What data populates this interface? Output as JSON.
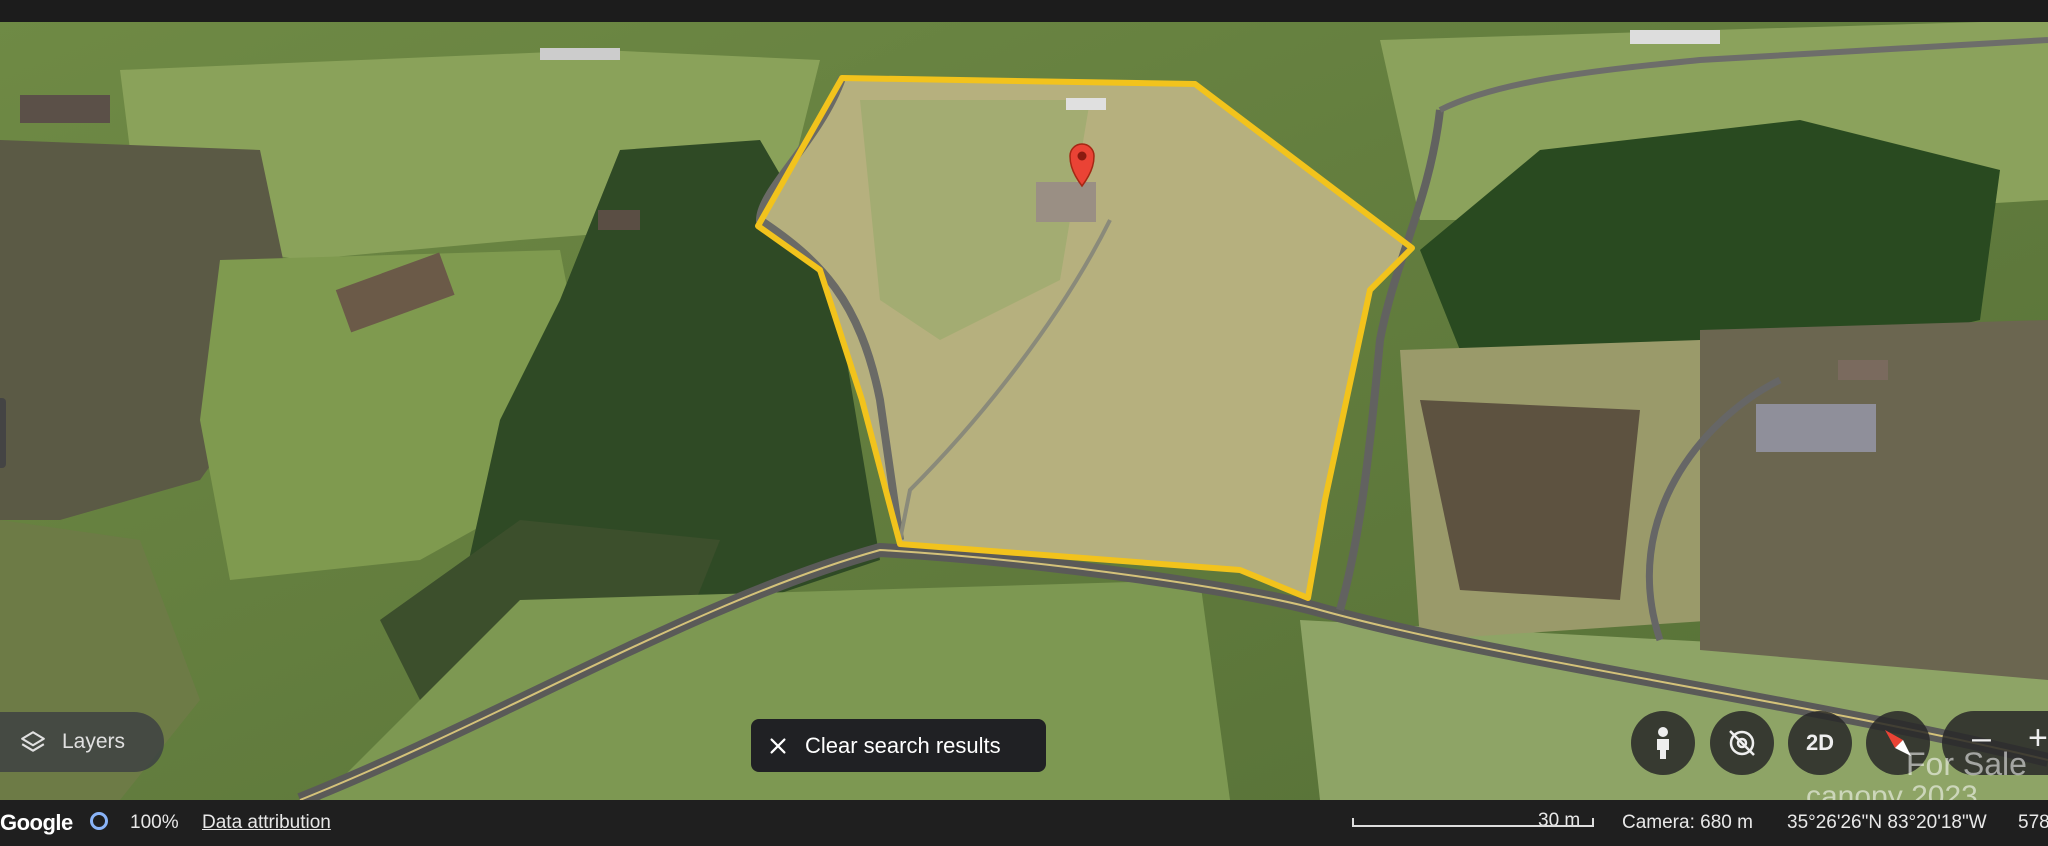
{
  "map": {
    "boundary_color": "#f2c31c",
    "marker_color": "#ea4335",
    "marker_icon": "map-pin-icon",
    "view": "satellite"
  },
  "layers_button": {
    "label": "Layers",
    "icon": "layers-icon"
  },
  "clear_search": {
    "label": "Clear search results",
    "icon": "close-icon"
  },
  "controls": {
    "pegman_icon": "pegman-icon",
    "rotate_icon": "rotate-icon",
    "view_toggle_label": "2D",
    "compass_icon": "compass-icon",
    "zoom_out_label": "–",
    "zoom_in_label": "+"
  },
  "status_bar": {
    "logo": "Google",
    "zoom_percent": "100%",
    "data_attribution": "Data attribution",
    "scale_label": "30 m",
    "camera": "Camera: 680 m",
    "coordinates": "35°26'26\"N 83°20'18\"W",
    "elevation": "578"
  },
  "watermark": {
    "line1": "For Sale",
    "line2": "canopy 2023"
  }
}
